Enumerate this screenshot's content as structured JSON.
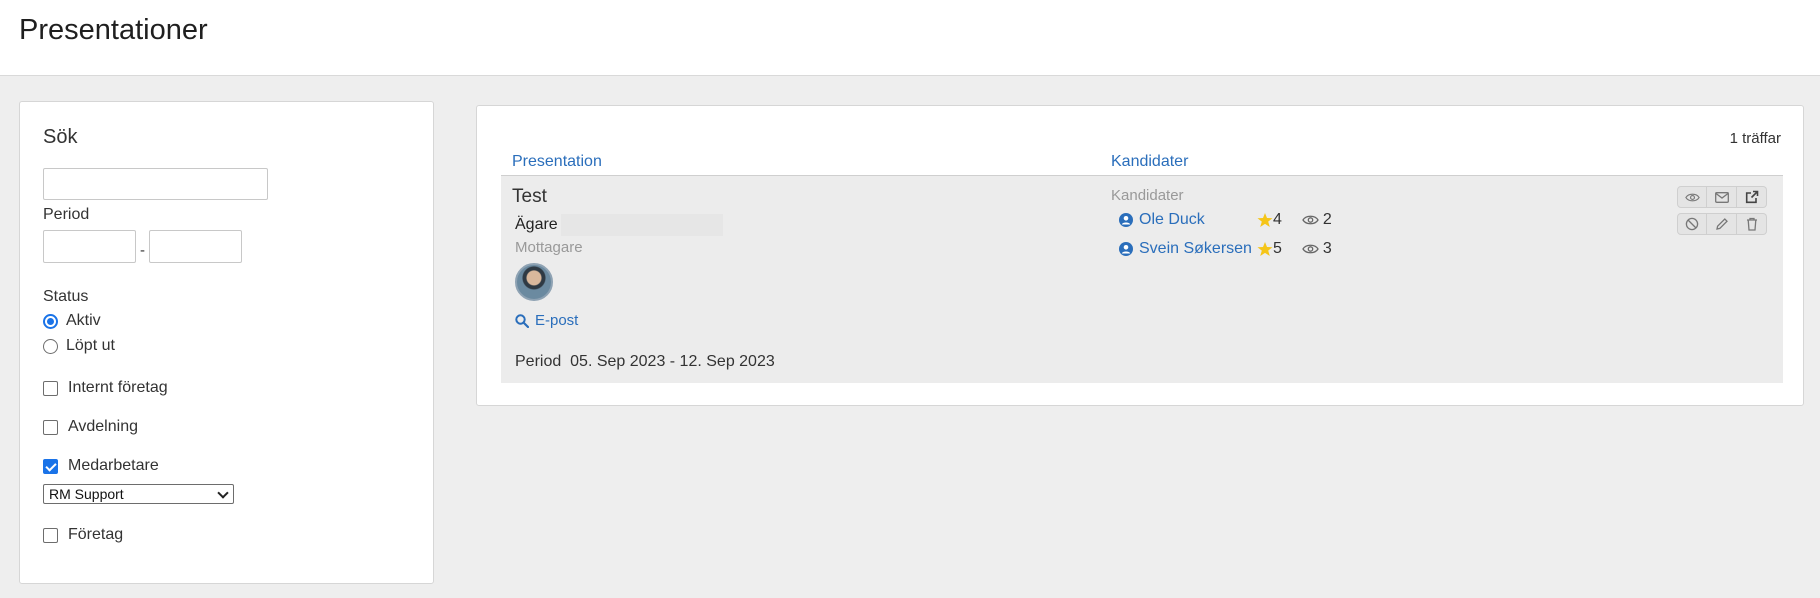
{
  "page": {
    "title": "Presentationer"
  },
  "search": {
    "heading": "Sök",
    "query_value": "",
    "period_label": "Period",
    "period_from": "",
    "period_to": "",
    "period_separator": "-",
    "status_label": "Status",
    "status_options": [
      {
        "label": "Aktiv",
        "selected": true
      },
      {
        "label": "Löpt ut",
        "selected": false
      }
    ],
    "filters": [
      {
        "label": "Internt företag",
        "checked": false
      },
      {
        "label": "Avdelning",
        "checked": false
      },
      {
        "label": "Medarbetare",
        "checked": true
      },
      {
        "label": "Företag",
        "checked": false
      }
    ],
    "employee_select": {
      "selected": "RM Support"
    }
  },
  "results": {
    "hits": "1 träffar",
    "columns": {
      "presentation": "Presentation",
      "candidates": "Kandidater"
    },
    "items": [
      {
        "title": "Test",
        "owner_label": "Ägare",
        "recipient_label": "Mottagare",
        "email_link": "E-post",
        "period_label": "Period",
        "period_value": "05. Sep 2023 - 12. Sep 2023",
        "candidates_label": "Kandidater",
        "candidates": [
          {
            "name": "Ole Duck",
            "stars": "4",
            "views": "2"
          },
          {
            "name": "Svein Søkersen",
            "stars": "5",
            "views": "3"
          }
        ],
        "actions": [
          "eye-icon",
          "envelope-icon",
          "external-link-icon",
          "block-icon",
          "pencil-icon",
          "trash-icon"
        ]
      }
    ]
  },
  "colors": {
    "link": "#2a6ebb",
    "accent": "#1a73e8",
    "star": "#f5c518"
  }
}
